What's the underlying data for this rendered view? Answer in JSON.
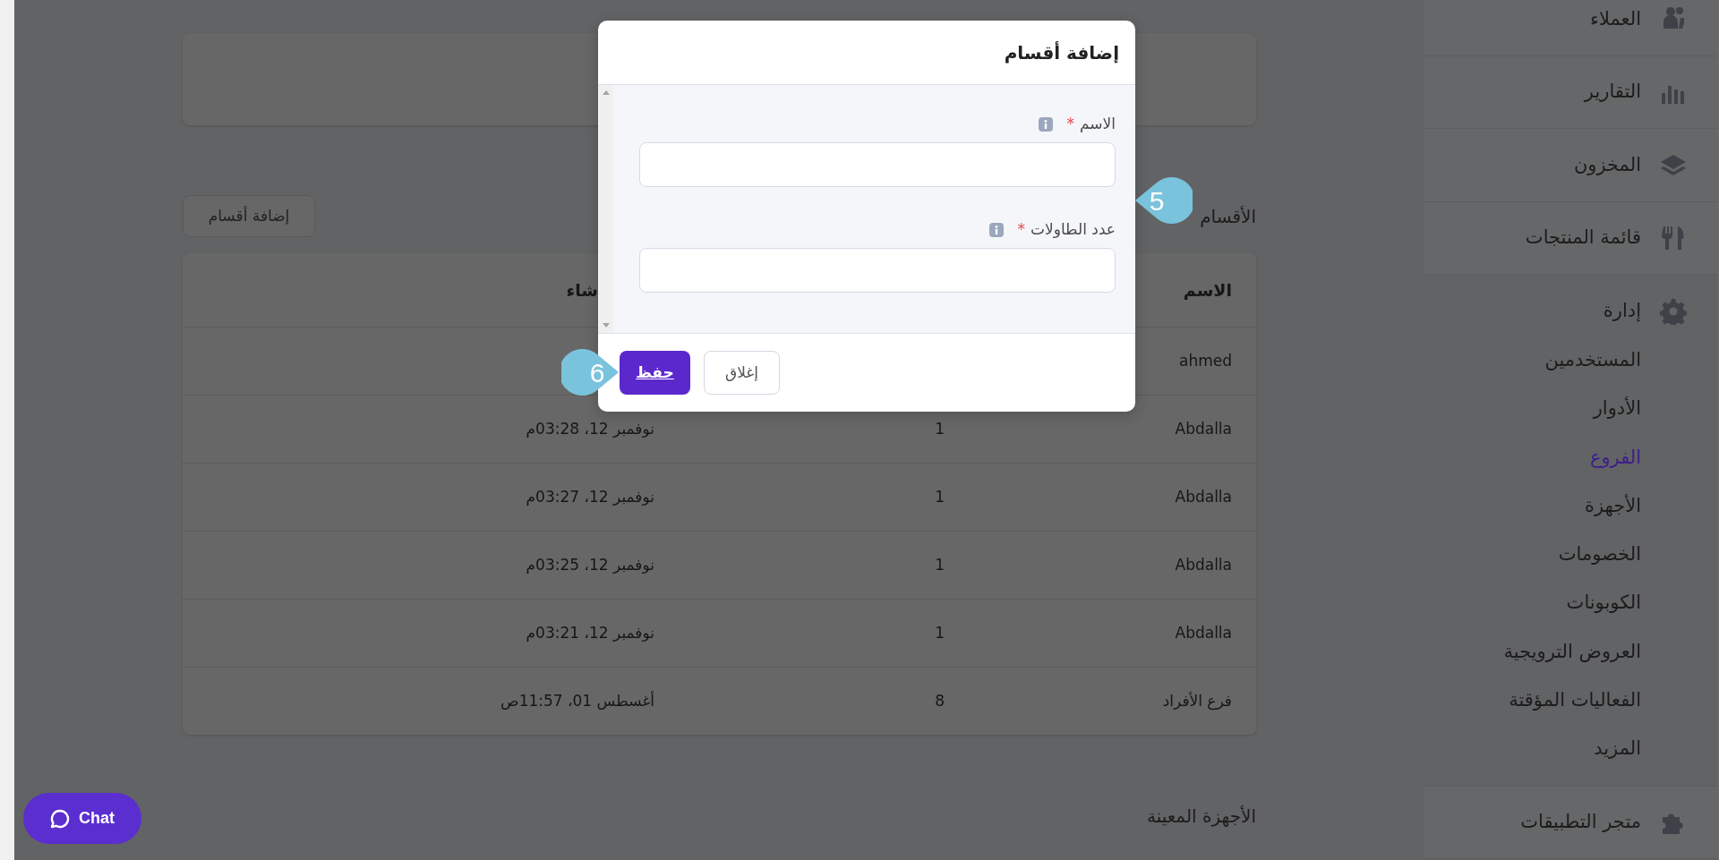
{
  "sidebar": {
    "items": [
      {
        "kind": "link",
        "label": "العملاء",
        "selected": false
      },
      {
        "kind": "link",
        "label": "التقارير",
        "selected": false
      },
      {
        "kind": "link",
        "label": "المخزون",
        "selected": false
      },
      {
        "kind": "link",
        "label": "قائمة المنتجات",
        "selected": false
      },
      {
        "kind": "group",
        "label": "إدارة",
        "expanded": true,
        "children": [
          {
            "label": "المستخدمين",
            "selected": false
          },
          {
            "label": "الأدوار",
            "selected": false
          },
          {
            "label": "الفروع",
            "selected": true
          },
          {
            "label": "الأجهزة",
            "selected": false
          },
          {
            "label": "الخصومات",
            "selected": false
          },
          {
            "label": "الكوبونات",
            "selected": false
          },
          {
            "label": "العروض الترويجية",
            "selected": false
          },
          {
            "label": "الفعاليات المؤقتة",
            "selected": false
          },
          {
            "label": "المزيد",
            "selected": false
          }
        ]
      },
      {
        "kind": "link",
        "label": "متجر التطبيقات",
        "selected": false
      }
    ]
  },
  "sections_heading": "الأقسام",
  "add_button": "إضافة أقسام",
  "table": {
    "columns": [
      {
        "label": "الاسم"
      },
      {},
      {
        "label": "شاء"
      }
    ],
    "rows": [
      {
        "name": "ahmed"
      },
      {
        "name": "Abdalla",
        "tables": "1",
        "created": "نوفمبر 12، 03:28م"
      },
      {
        "name": "Abdalla",
        "tables": "1",
        "created": "نوفمبر 12، 03:27م"
      },
      {
        "name": "Abdalla",
        "tables": "1",
        "created": "نوفمبر 12، 03:25م"
      },
      {
        "name": "Abdalla",
        "tables": "1",
        "created": "نوفمبر 12، 03:21م"
      },
      {
        "name": "فرع الأفراد",
        "tables": "8",
        "created": "أغسطس 01، 11:57ص"
      }
    ]
  },
  "devices_heading": "الأجهزة المعينة",
  "modal": {
    "title": "إضافة أقسام",
    "fields": [
      {
        "label": "الاسم",
        "required_mark": "*"
      },
      {
        "label": "عدد الطاولات",
        "required_mark": "*"
      }
    ],
    "buttons": [
      {
        "label": "إغلاق",
        "kind": "secondary"
      },
      {
        "label": "حفظ",
        "kind": "primary"
      }
    ]
  },
  "callouts": [
    {
      "number": "5"
    },
    {
      "number": "6"
    }
  ],
  "chat_button": "Chat"
}
